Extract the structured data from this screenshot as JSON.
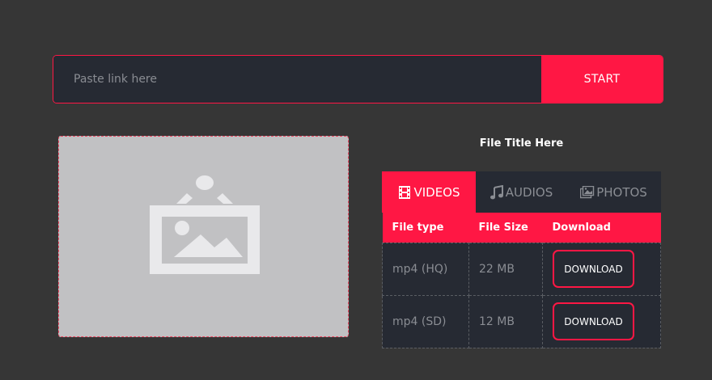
{
  "search": {
    "placeholder": "Paste link here",
    "start_label": "START"
  },
  "file": {
    "title": "File Title Here"
  },
  "tabs": [
    {
      "label": "VIDEOS",
      "icon": "film-icon",
      "active": true
    },
    {
      "label": "AUDIOS",
      "icon": "music-note-icon",
      "active": false
    },
    {
      "label": "PHOTOS",
      "icon": "photos-icon",
      "active": false
    }
  ],
  "table": {
    "headers": [
      "File type",
      "File Size",
      "Download"
    ],
    "rows": [
      {
        "type": "mp4 (HQ)",
        "size": "22 MB",
        "action": "DOWNLOAD"
      },
      {
        "type": "mp4 (SD)",
        "size": "12 MB",
        "action": "DOWNLOAD"
      }
    ]
  },
  "colors": {
    "accent": "#ff1744",
    "background": "#363636",
    "panel": "#262a33",
    "muted_text": "#8a8d93"
  }
}
